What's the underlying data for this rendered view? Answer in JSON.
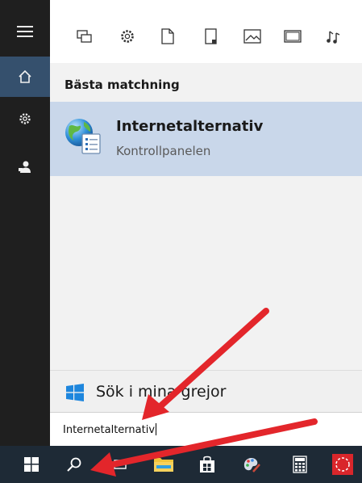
{
  "rail": {
    "items": [
      {
        "icon": "hamburger-menu-icon"
      },
      {
        "icon": "home-icon",
        "active": true
      },
      {
        "icon": "settings-gear-icon"
      },
      {
        "icon": "feedback-icon"
      }
    ]
  },
  "filters": {
    "items": [
      {
        "icon": "apps-filter-icon"
      },
      {
        "icon": "settings-filter-icon"
      },
      {
        "icon": "documents-filter-icon"
      },
      {
        "icon": "folders-filter-icon"
      },
      {
        "icon": "photos-filter-icon"
      },
      {
        "icon": "videos-filter-icon"
      },
      {
        "icon": "music-filter-icon"
      }
    ]
  },
  "results": {
    "section_header": "Bästa matchning",
    "best_match": {
      "icon": "internet-options-globe-icon",
      "title": "Internetalternativ",
      "subtitle": "Kontrollpanelen"
    }
  },
  "my_stuff": {
    "label": "Sök i mina grejor"
  },
  "search": {
    "value": "Internetalternativ"
  },
  "taskbar": {
    "items": [
      {
        "icon": "start-windows-icon"
      },
      {
        "icon": "search-icon"
      },
      {
        "icon": "task-view-icon"
      },
      {
        "icon": "file-explorer-icon"
      },
      {
        "icon": "store-icon"
      },
      {
        "icon": "paint-icon"
      },
      {
        "icon": "calculator-icon"
      },
      {
        "icon": "red-app-icon"
      }
    ]
  },
  "colors": {
    "rail": "#1f1f1f",
    "rail_active": "#35506d",
    "highlight": "#c9d7ea",
    "taskbar": "#1e2a36",
    "arrow": "#e3262b"
  }
}
